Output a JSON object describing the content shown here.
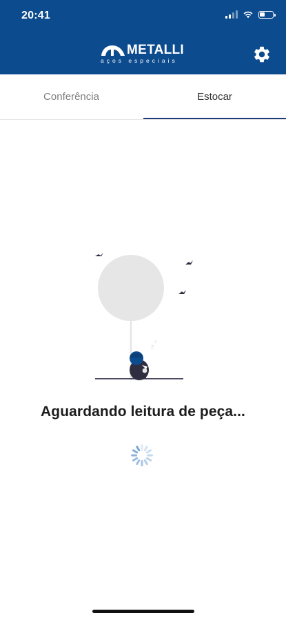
{
  "status_bar": {
    "time": "20:41",
    "battery_level": 0.4
  },
  "header": {
    "logo_name": "METALLI",
    "logo_tagline": "aços especiais",
    "settings_icon": "gear-icon",
    "background_color": "#0c4b8e"
  },
  "tabs": [
    {
      "label": "Conferência",
      "selected": false
    },
    {
      "label": "Estocar",
      "selected": true
    }
  ],
  "main": {
    "message": "Aguardando leitura de peça..."
  },
  "colors": {
    "accent": "#1f3c7a",
    "spinner": "#7aa7d6"
  }
}
